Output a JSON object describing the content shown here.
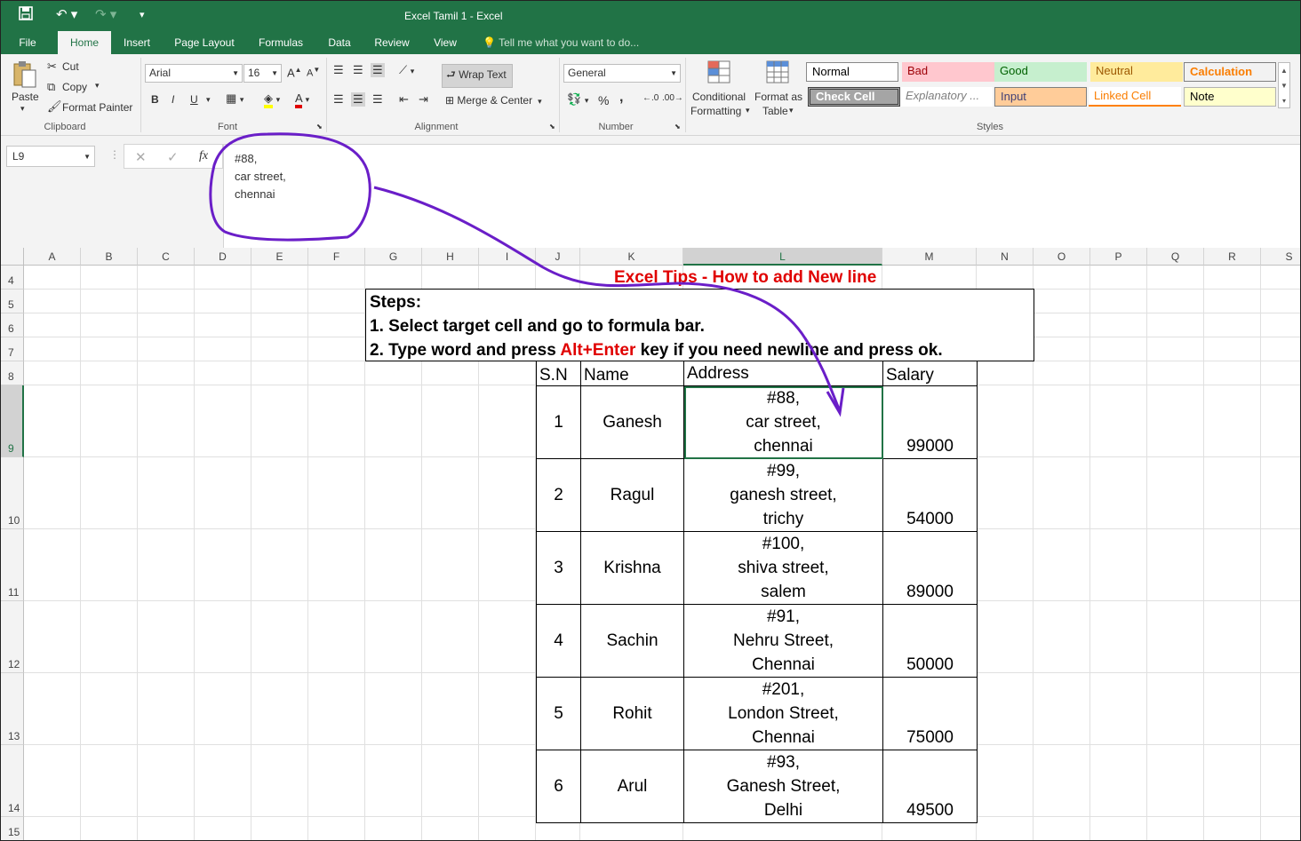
{
  "window": {
    "title": "Excel Tamil 1 - Excel"
  },
  "tabs": [
    "File",
    "Home",
    "Insert",
    "Page Layout",
    "Formulas",
    "Data",
    "Review",
    "View"
  ],
  "tell_me": "Tell me what you want to do...",
  "ribbon": {
    "clipboard": {
      "paste": "Paste",
      "cut": "Cut",
      "copy": "Copy",
      "format_painter": "Format Painter",
      "label": "Clipboard"
    },
    "font": {
      "name": "Arial",
      "size": "16",
      "label": "Font",
      "bold": "B",
      "italic": "I",
      "underline": "U"
    },
    "alignment": {
      "wrap_text": "Wrap Text",
      "merge_center": "Merge & Center",
      "label": "Alignment"
    },
    "number": {
      "format": "General",
      "label": "Number",
      "percent": "%",
      "comma": ","
    },
    "conditional": {
      "line1": "Conditional",
      "line2": "Formatting"
    },
    "format_as_table": {
      "line1": "Format as",
      "line2": "Table"
    },
    "styles": {
      "label": "Styles",
      "normal": "Normal",
      "bad": "Bad",
      "good": "Good",
      "neutral": "Neutral",
      "calculation": "Calculation",
      "check_cell": "Check Cell",
      "explanatory": "Explanatory ...",
      "input": "Input",
      "linked_cell": "Linked Cell",
      "note": "Note"
    }
  },
  "formula_bar": {
    "name_box": "L9",
    "fx": "fx",
    "content_lines": [
      "#88,",
      "car street,",
      "chennai"
    ]
  },
  "columns": [
    "A",
    "B",
    "C",
    "D",
    "E",
    "F",
    "G",
    "H",
    "I",
    "J",
    "K",
    "L",
    "M",
    "N",
    "O",
    "P",
    "Q",
    "R",
    "S"
  ],
  "rows": [
    "4",
    "5",
    "6",
    "7",
    "8",
    "9",
    "10",
    "11",
    "12",
    "13",
    "14",
    "15"
  ],
  "sheet": {
    "tip_title": "Excel Tips - How to add New line",
    "steps_heading": "Steps:",
    "step1": "1. Select target cell and go to formula bar.",
    "step2_pre": "2. Type word and press ",
    "step2_key": "Alt+Enter",
    "step2_post": " key if you need newline and press ok.",
    "table": {
      "headers": [
        "S.N",
        "Name",
        "Address",
        "Salary"
      ],
      "rows": [
        {
          "sn": "1",
          "name": "Ganesh",
          "addr": [
            "#88,",
            "car street,",
            "chennai"
          ],
          "salary": "99000"
        },
        {
          "sn": "2",
          "name": "Ragul",
          "addr": [
            "#99,",
            "ganesh street,",
            "trichy"
          ],
          "salary": "54000"
        },
        {
          "sn": "3",
          "name": "Krishna",
          "addr": [
            "#100,",
            "shiva street,",
            "salem"
          ],
          "salary": "89000"
        },
        {
          "sn": "4",
          "name": "Sachin",
          "addr": [
            "#91,",
            "Nehru Street,",
            "Chennai"
          ],
          "salary": "50000"
        },
        {
          "sn": "5",
          "name": "Rohit",
          "addr": [
            "#201,",
            "London Street,",
            "Chennai"
          ],
          "salary": "75000"
        },
        {
          "sn": "6",
          "name": "Arul",
          "addr": [
            "#93,",
            "Ganesh Street,",
            "Delhi"
          ],
          "salary": "49500"
        }
      ]
    }
  },
  "colors": {
    "excel_green": "#217346",
    "annotation": "#6a1ec8",
    "tip_red": "#e00000"
  }
}
